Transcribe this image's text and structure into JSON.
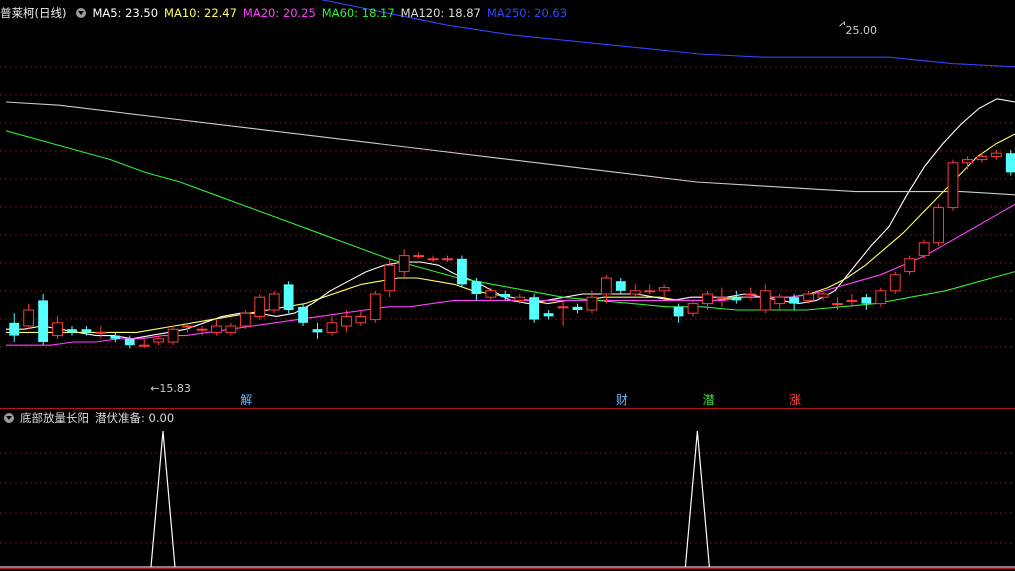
{
  "header": {
    "title": "普莱柯(日线)",
    "ma": [
      {
        "label": "MA5: 23.50",
        "color": "#ffffff"
      },
      {
        "label": "MA10: 22.47",
        "color": "#ffff66"
      },
      {
        "label": "MA20: 20.25",
        "color": "#ff40ff"
      },
      {
        "label": "MA60: 18.17",
        "color": "#33ee33"
      },
      {
        "label": "MA120: 18.87",
        "color": "#dddddd"
      },
      {
        "label": "MA250: 20.63",
        "color": "#3344ff"
      }
    ]
  },
  "indicator": {
    "title": "底部放量长阳",
    "value_label": "潜伏准备: 0.00"
  },
  "markers": [
    {
      "text": "解",
      "index": 16,
      "color": "#66bbff"
    },
    {
      "text": "财",
      "index": 42,
      "color": "#66bbff"
    },
    {
      "text": "潜",
      "index": 48,
      "color": "#33dd33"
    },
    {
      "text": "涨",
      "index": 54,
      "color": "#ff4444"
    }
  ],
  "colors": {
    "up": "#ff3b3b",
    "down": "#55ffff",
    "grid": "#7a1010"
  },
  "chart_data": {
    "type": "candlestick",
    "price_range": [
      14.5,
      26.0
    ],
    "low_annotation": {
      "text": "15.83",
      "index": 9
    },
    "high_annotation": {
      "text": "25.00",
      "index": 57
    },
    "candles": [
      [
        16.6,
        16.2,
        16.9,
        16.0
      ],
      [
        16.5,
        17.0,
        17.2,
        16.4
      ],
      [
        17.3,
        16.0,
        17.5,
        15.9
      ],
      [
        16.2,
        16.6,
        16.8,
        16.1
      ],
      [
        16.4,
        16.3,
        16.5,
        16.2
      ],
      [
        16.4,
        16.3,
        16.5,
        16.2
      ],
      [
        16.3,
        16.3,
        16.5,
        16.1
      ],
      [
        16.2,
        16.1,
        16.3,
        16.0
      ],
      [
        16.1,
        15.9,
        16.2,
        15.8
      ],
      [
        15.9,
        15.9,
        16.1,
        15.8
      ],
      [
        16.0,
        16.1,
        16.2,
        15.9
      ],
      [
        16.0,
        16.4,
        16.5,
        15.9
      ],
      [
        16.5,
        16.5,
        16.6,
        16.3
      ],
      [
        16.4,
        16.4,
        16.5,
        16.2
      ],
      [
        16.3,
        16.5,
        16.7,
        16.2
      ],
      [
        16.3,
        16.5,
        16.6,
        16.2
      ],
      [
        16.5,
        16.9,
        17.0,
        16.4
      ],
      [
        16.8,
        17.4,
        17.5,
        16.7
      ],
      [
        17.0,
        17.5,
        17.6,
        16.9
      ],
      [
        17.8,
        17.0,
        17.9,
        16.9
      ],
      [
        17.1,
        16.6,
        17.2,
        16.5
      ],
      [
        16.4,
        16.3,
        16.6,
        16.1
      ],
      [
        16.3,
        16.6,
        16.8,
        16.2
      ],
      [
        16.5,
        16.8,
        17.0,
        16.3
      ],
      [
        16.6,
        16.8,
        17.0,
        16.5
      ],
      [
        16.7,
        17.5,
        17.6,
        16.6
      ],
      [
        17.6,
        18.4,
        18.6,
        17.4
      ],
      [
        18.2,
        18.7,
        18.9,
        18.0
      ],
      [
        18.7,
        18.7,
        18.8,
        18.6
      ],
      [
        18.6,
        18.6,
        18.7,
        18.5
      ],
      [
        18.6,
        18.6,
        18.7,
        18.5
      ],
      [
        18.6,
        17.8,
        18.7,
        17.7
      ],
      [
        17.9,
        17.5,
        18.0,
        17.3
      ],
      [
        17.4,
        17.6,
        17.7,
        17.3
      ],
      [
        17.5,
        17.4,
        17.6,
        17.3
      ],
      [
        17.3,
        17.4,
        17.5,
        17.2
      ],
      [
        17.4,
        16.7,
        17.5,
        16.6
      ],
      [
        16.9,
        16.8,
        17.0,
        16.7
      ],
      [
        17.1,
        17.1,
        17.3,
        16.5
      ],
      [
        17.1,
        17.0,
        17.2,
        16.9
      ],
      [
        17.0,
        17.4,
        17.6,
        16.9
      ],
      [
        17.5,
        18.0,
        18.1,
        17.2
      ],
      [
        17.9,
        17.6,
        18.0,
        17.5
      ],
      [
        17.5,
        17.6,
        17.8,
        17.4
      ],
      [
        17.6,
        17.6,
        17.8,
        17.5
      ],
      [
        17.6,
        17.7,
        17.8,
        17.4
      ],
      [
        17.1,
        16.8,
        17.2,
        16.6
      ],
      [
        16.9,
        17.2,
        17.3,
        16.8
      ],
      [
        17.2,
        17.5,
        17.6,
        17.0
      ],
      [
        17.4,
        17.4,
        17.7,
        17.1
      ],
      [
        17.4,
        17.3,
        17.6,
        17.2
      ],
      [
        17.5,
        17.5,
        17.7,
        17.3
      ],
      [
        17.0,
        17.6,
        17.8,
        16.9
      ],
      [
        17.2,
        17.4,
        17.5,
        17.0
      ],
      [
        17.4,
        17.2,
        17.5,
        17.0
      ],
      [
        17.3,
        17.5,
        17.6,
        17.2
      ],
      [
        17.4,
        17.5,
        17.6,
        17.3
      ],
      [
        17.2,
        17.2,
        17.4,
        17.0
      ],
      [
        17.3,
        17.3,
        17.5,
        17.1
      ],
      [
        17.4,
        17.2,
        17.5,
        17.0
      ]
    ],
    "candles_tail": [
      [
        17.2,
        17.6,
        17.7,
        17.1
      ],
      [
        17.6,
        18.1,
        18.2,
        17.5
      ],
      [
        18.2,
        18.6,
        18.7,
        18.1
      ],
      [
        18.7,
        19.1,
        19.2,
        18.6
      ],
      [
        19.1,
        20.2,
        20.3,
        19.0
      ],
      [
        20.2,
        21.6,
        21.7,
        20.1
      ],
      [
        21.6,
        21.7,
        21.8,
        21.4
      ],
      [
        21.7,
        21.8,
        21.9,
        21.6
      ],
      [
        21.8,
        21.9,
        22.0,
        21.7
      ],
      [
        21.9,
        21.3,
        22.0,
        21.2
      ]
    ],
    "ma": {
      "MA5": [
        16.4,
        16.4,
        16.5,
        16.4,
        16.3,
        16.2,
        16.2,
        16.1,
        16.2,
        16.3,
        16.4,
        16.6,
        16.8,
        16.9,
        16.9,
        16.8,
        16.9,
        17.2,
        17.6,
        17.9,
        18.2,
        18.4,
        18.5,
        18.5,
        18.4,
        18.1,
        17.9,
        17.6,
        17.3,
        17.2,
        17.3,
        17.4,
        17.5,
        17.5,
        17.5,
        17.5,
        17.4,
        17.3,
        17.4,
        17.4,
        17.4,
        17.5,
        17.4,
        17.3,
        17.2,
        17.3,
        17.6,
        18.3,
        19.0,
        19.6,
        20.6,
        21.5,
        22.2,
        22.8,
        23.3,
        23.6,
        23.5
      ],
      "MA10": [
        16.3,
        16.3,
        16.3,
        16.3,
        16.3,
        16.3,
        16.3,
        16.3,
        16.4,
        16.5,
        16.6,
        16.7,
        16.8,
        16.9,
        17.0,
        17.1,
        17.2,
        17.4,
        17.6,
        17.8,
        17.9,
        18.0,
        18.0,
        17.9,
        17.8,
        17.6,
        17.5,
        17.4,
        17.3,
        17.2,
        17.3,
        17.3,
        17.4,
        17.4,
        17.4,
        17.4,
        17.3,
        17.3,
        17.3,
        17.4,
        17.4,
        17.4,
        17.4,
        17.5,
        17.7,
        18.0,
        18.4,
        18.9,
        19.4,
        20.0,
        20.6,
        21.2,
        21.8,
        22.2,
        22.5
      ],
      "MA20": [
        15.9,
        15.9,
        15.9,
        16.0,
        16.0,
        16.1,
        16.1,
        16.2,
        16.2,
        16.3,
        16.4,
        16.5,
        16.6,
        16.7,
        16.8,
        16.9,
        17.0,
        17.1,
        17.1,
        17.2,
        17.3,
        17.3,
        17.3,
        17.3,
        17.3,
        17.3,
        17.3,
        17.3,
        17.3,
        17.3,
        17.3,
        17.3,
        17.3,
        17.4,
        17.4,
        17.4,
        17.5,
        17.7,
        17.9,
        18.1,
        18.4,
        18.7,
        19.1,
        19.5,
        19.9,
        20.3
      ],
      "MA60": [
        22.6,
        22.3,
        22.0,
        21.7,
        21.3,
        21.0,
        20.6,
        20.2,
        19.8,
        19.4,
        19.0,
        18.6,
        18.3,
        18.0,
        17.8,
        17.6,
        17.4,
        17.3,
        17.2,
        17.1,
        17.1,
        17.0,
        17.0,
        17.0,
        17.1,
        17.2,
        17.4,
        17.6,
        17.9,
        18.2
      ],
      "MA120": [
        23.5,
        23.4,
        23.2,
        23.0,
        22.8,
        22.6,
        22.4,
        22.2,
        22.0,
        21.8,
        21.6,
        21.4,
        21.2,
        21.0,
        20.9,
        20.8,
        20.7,
        20.7,
        20.7,
        20.6
      ],
      "MA250": [
        28.8,
        28.4,
        27.9,
        27.5,
        27.1,
        26.7,
        26.3,
        25.9,
        25.6,
        25.4,
        25.2,
        25.0,
        24.9,
        24.9,
        24.9,
        24.7,
        24.6
      ]
    },
    "indicator": {
      "name": "潜伏准备",
      "spikes_at": [
        10,
        47
      ],
      "range": [
        0,
        1
      ]
    }
  }
}
